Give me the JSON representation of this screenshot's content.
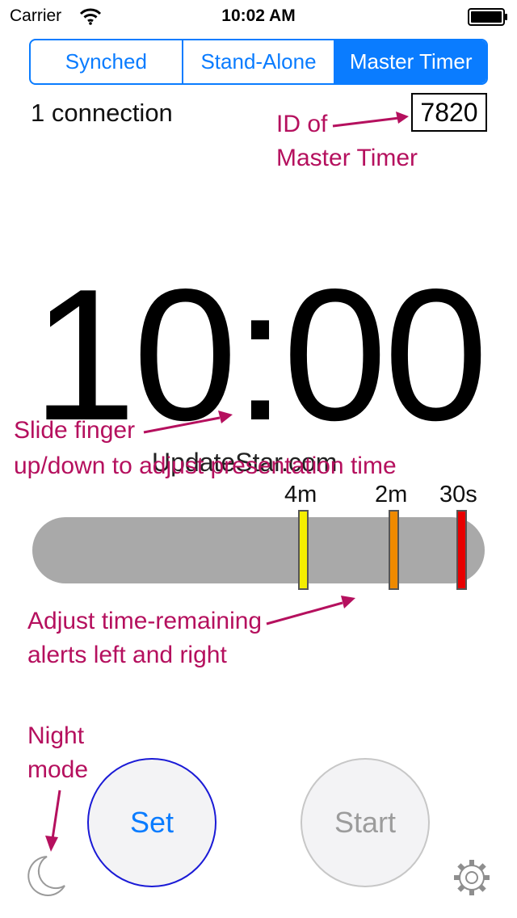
{
  "status_bar": {
    "carrier": "Carrier",
    "time": "10:02 AM"
  },
  "mode_tabs": [
    {
      "label": "Synched",
      "selected": false
    },
    {
      "label": "Stand-Alone",
      "selected": false
    },
    {
      "label": "Master Timer",
      "selected": true
    }
  ],
  "connection_status": "1 connection",
  "master_timer_id": "7820",
  "timer_display": "10:00",
  "watermark": "UpdateStar.com",
  "alert_labels": [
    "4m",
    "2m",
    "30s"
  ],
  "alert_marker_colors": [
    "#f4ee00",
    "#ef8a00",
    "#e80000"
  ],
  "annotations": {
    "id_line1": "ID of",
    "id_line2": "Master Timer",
    "slide_line1": "Slide finger",
    "slide_line2": "up/down to adjust presentation time",
    "alerts_line1": "Adjust time-remaining",
    "alerts_line2": "alerts left and right",
    "night_line1": "Night",
    "night_line2": "mode"
  },
  "buttons": {
    "set_label": "Set",
    "start_label": "Start"
  },
  "icons": {
    "wifi": "wifi-icon",
    "battery": "battery-icon",
    "night_mode": "moon-icon",
    "settings": "gear-icon"
  },
  "colors": {
    "accent": "#0a7cff",
    "annotation": "#b5105e",
    "track": "#a9a9a9"
  }
}
